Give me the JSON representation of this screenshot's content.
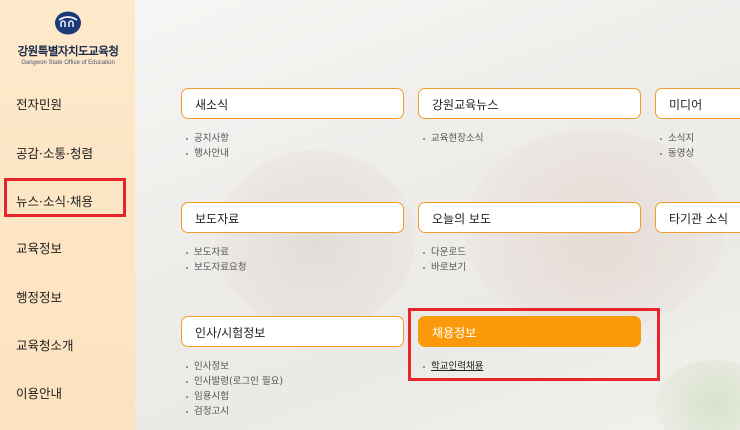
{
  "org": {
    "name": "강원특별자치도교육청",
    "subtitle": "Gangwon State Office of Education"
  },
  "sidebar": {
    "items": [
      {
        "label": "전자민원"
      },
      {
        "label": "공감·소통·청렴"
      },
      {
        "label": "뉴스·소식·채용"
      },
      {
        "label": "교육정보"
      },
      {
        "label": "행정정보"
      },
      {
        "label": "교육청소개"
      },
      {
        "label": "이용안내"
      }
    ]
  },
  "menu": {
    "new_news": {
      "title": "새소식",
      "links": [
        "공지사항",
        "행사안내"
      ]
    },
    "gangwon_news": {
      "title": "강원교육뉴스",
      "links": [
        "교육현장소식"
      ]
    },
    "media": {
      "title": "미디어",
      "links": [
        "소식지",
        "동영상"
      ]
    },
    "press": {
      "title": "보도자료",
      "links": [
        "보도자료",
        "보도자료요청"
      ]
    },
    "today_press": {
      "title": "오늘의 보도",
      "links": [
        "다운로드",
        "바로보기"
      ]
    },
    "other_news": {
      "title": "타기관 소식",
      "links": []
    },
    "personnel": {
      "title": "인사/시험정보",
      "links": [
        "인사정보",
        "인사발령(로그인 필요)",
        "임용시험",
        "검정고시"
      ]
    },
    "recruit": {
      "title": "채용정보",
      "links": [
        "학교인력채용"
      ]
    }
  },
  "colors": {
    "accent": "#fa9a0b",
    "highlight": "#e8262a",
    "sidebar_bg": "#fde9cb"
  }
}
